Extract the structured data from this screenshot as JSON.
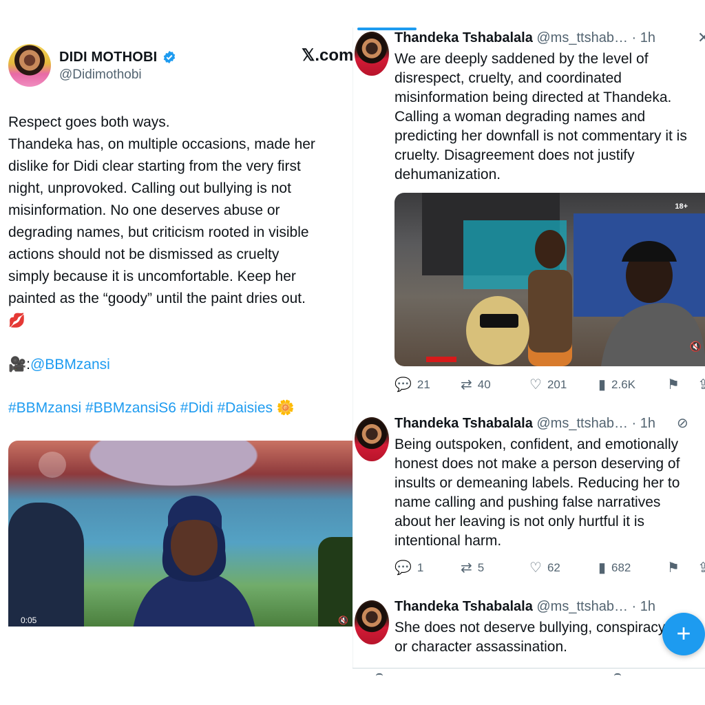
{
  "left_tweet": {
    "author_name": "DIDI MOTHOBI",
    "handle": "@Didimothobi",
    "watermark": "𝕏.com",
    "paragraph_1": "Respect goes both ways.",
    "paragraph_2_lines": [
      "Thandeka has, on multiple occasions, made her",
      "dislike for Didi clear starting from the very first",
      "night, unprovoked. Calling out bullying is not",
      "misinformation. No one deserves abuse or",
      "degrading names, but criticism rooted in visible",
      "actions should not be dismissed as cruelty",
      "simply because it is uncomfortable. Keep her",
      "painted as the “goody” until the paint dries out."
    ],
    "lips_emoji": "💋",
    "credit_prefix": "🎥:",
    "credit_link": "@BBMzansi",
    "hashtags": "#BBMzansi #BBMzansiS6 #Didi #Daisies",
    "hashtag_emoji": "🌼",
    "video_time": "0:05"
  },
  "right_thread": {
    "tweets": [
      {
        "name": "Thandeka Tshabalala",
        "meta": "@ms_ttshab… · 1h",
        "lines": [
          "We are deeply saddened by the level of",
          "disrespect, cruelty, and coordinated",
          "misinformation being directed at Thandeka.",
          "Calling a woman degrading names and",
          "predicting her downfall is not commentary it is",
          "cruelty. Disagreement does not justify",
          "dehumanization."
        ],
        "media_age_badge": "18+",
        "replies": "21",
        "reposts": "40",
        "likes": "201",
        "views": "2.6K"
      },
      {
        "name": "Thandeka Tshabalala",
        "meta": "@ms_ttshab… · 1h",
        "lines": [
          "Being outspoken, confident, and emotionally",
          "honest does not make a person deserving of",
          "insults or demeaning labels. Reducing her to",
          "name calling and pushing false narratives",
          "about her leaving is not only hurtful  it is",
          "intentional harm."
        ],
        "replies": "1",
        "reposts": "5",
        "likes": "62",
        "views": "682"
      },
      {
        "name": "Thandeka Tshabalala",
        "meta": "@ms_ttshab… · 1h",
        "lines": [
          "She does not deserve bullying, conspiracy",
          "or character assassination."
        ]
      }
    ]
  },
  "icons": {
    "reply": "reply-icon",
    "repost": "repost-icon",
    "like": "heart-icon",
    "views": "views-icon",
    "bookmark": "bookmark-icon",
    "compose": "compose-icon"
  },
  "colors": {
    "accent": "#1d9bf0",
    "text": "#0f1419",
    "muted": "#536471"
  }
}
